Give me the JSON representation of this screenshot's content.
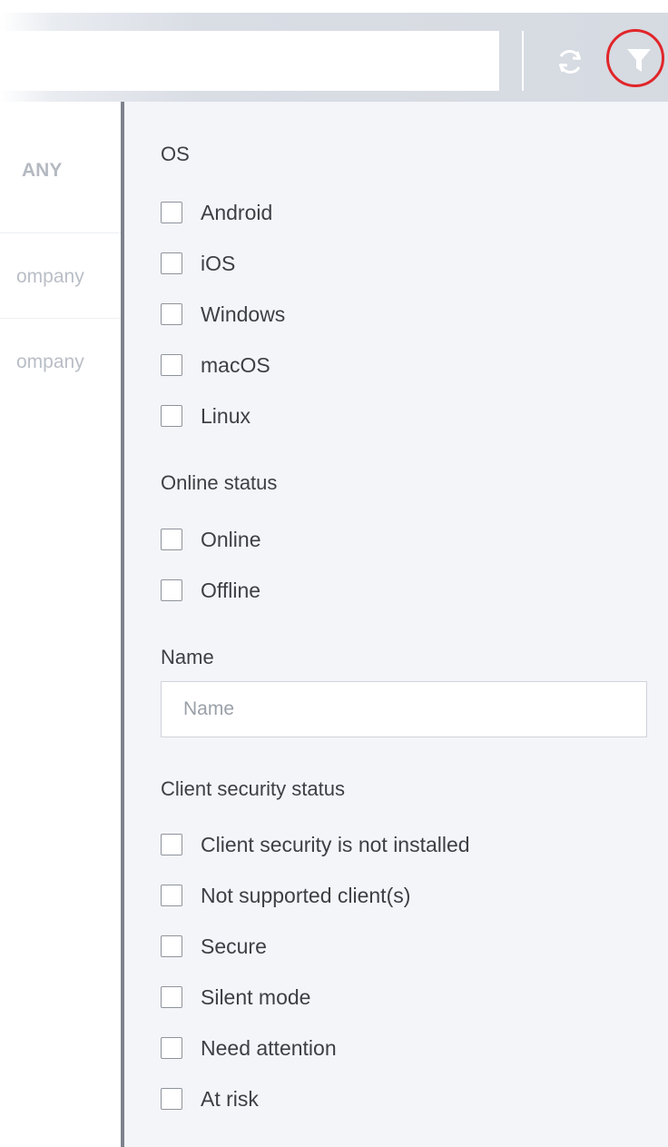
{
  "toolbar": {
    "search_value": "",
    "icons": {
      "refresh": "refresh-icon",
      "filter": "filter-icon"
    },
    "highlight_color": "#e0262a"
  },
  "background_table": {
    "header": "ANY",
    "rows": [
      "ompany",
      "ompany"
    ]
  },
  "filter_panel": {
    "os": {
      "title": "OS",
      "options": [
        "Android",
        "iOS",
        "Windows",
        "macOS",
        "Linux"
      ]
    },
    "online_status": {
      "title": "Online status",
      "options": [
        "Online",
        "Offline"
      ]
    },
    "name": {
      "title": "Name",
      "placeholder": "Name",
      "value": ""
    },
    "client_security_status": {
      "title": "Client security status",
      "options": [
        "Client security is not installed",
        "Not supported client(s)",
        "Secure",
        "Silent mode",
        "Need attention",
        "At risk"
      ]
    }
  }
}
